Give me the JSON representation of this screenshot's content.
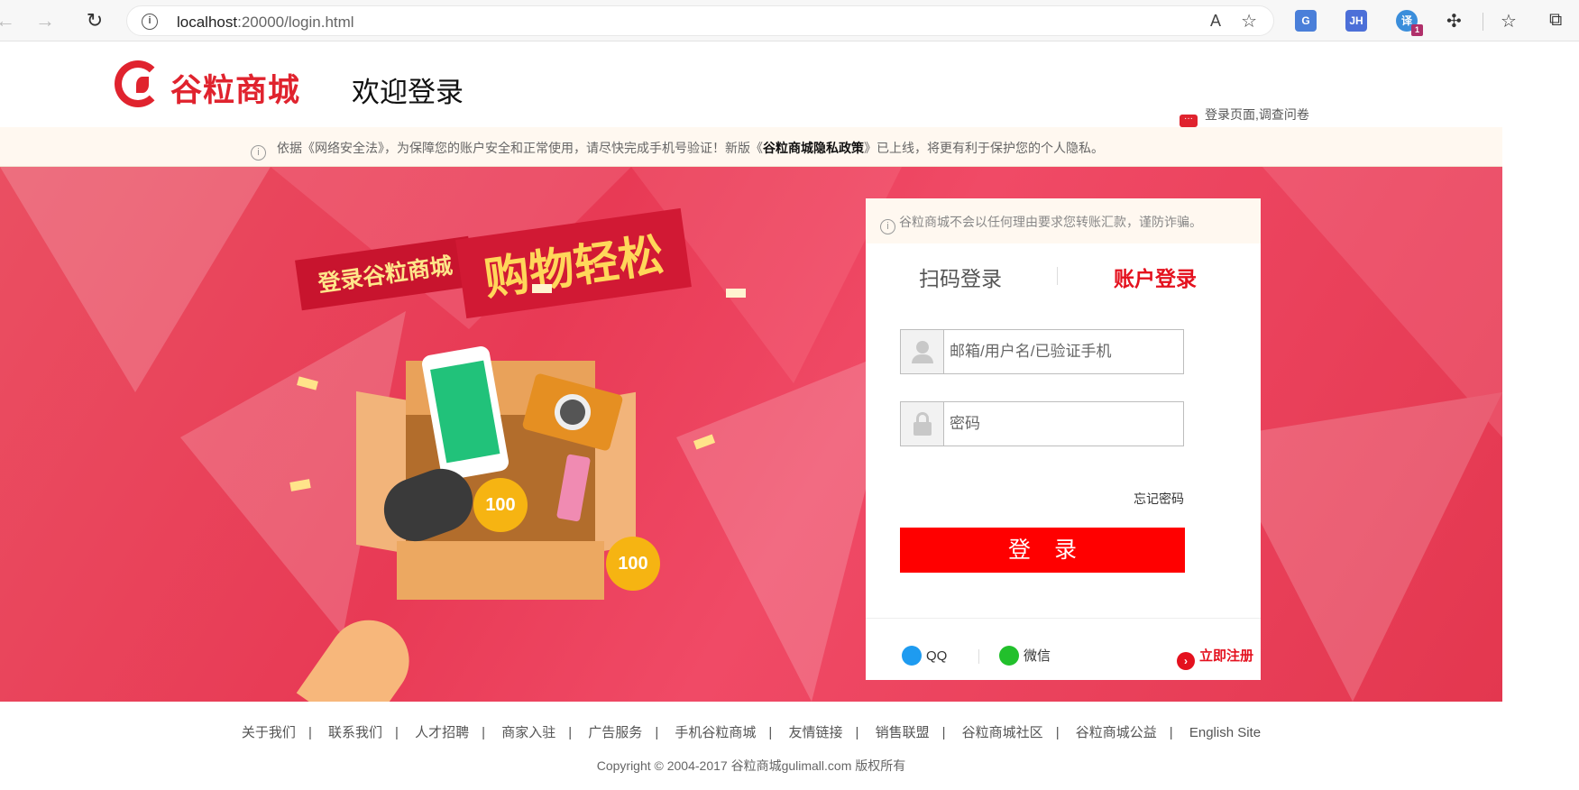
{
  "browser": {
    "url_host": "localhost",
    "url_rest": ":20000/login.html",
    "ext_g": "G",
    "ext_jh": "JH",
    "ext_tr": "译",
    "ext_tr_badge": "1"
  },
  "header": {
    "logo_text": "谷粒商城",
    "welcome": "欢迎登录",
    "survey": "登录页面,调查问卷"
  },
  "notice": {
    "pre": "依据《网络安全法》，为保障您的账户安全和正常使用，请尽快完成手机号验证！新版《",
    "bold": "谷粒商城隐私政策",
    "post": "》已上线，将更有利于保护您的个人隐私。"
  },
  "banner": {
    "slogan_small": "登录谷粒商城",
    "slogan_big": "购物轻松",
    "tag": "100"
  },
  "login": {
    "tip": "谷粒商城不会以任何理由要求您转账汇款，谨防诈骗。",
    "tab_scan": "扫码登录",
    "tab_account": "账户登录",
    "username_placeholder": "邮箱/用户名/已验证手机",
    "password_placeholder": "密码",
    "forgot": "忘记密码",
    "submit": "登录",
    "qq": "QQ",
    "wechat": "微信",
    "register": "立即注册"
  },
  "footer": {
    "links": [
      "关于我们",
      "联系我们",
      "人才招聘",
      "商家入驻",
      "广告服务",
      "手机谷粒商城",
      "友情链接",
      "销售联盟",
      "谷粒商城社区",
      "谷粒商城公益",
      "English Site"
    ],
    "copyright": "Copyright © 2004-2017 谷粒商城gulimall.com 版权所有"
  },
  "colors": {
    "brand_red": "#e0232e",
    "button_red": "#ff0000",
    "banner_bg": "#e83a55"
  }
}
